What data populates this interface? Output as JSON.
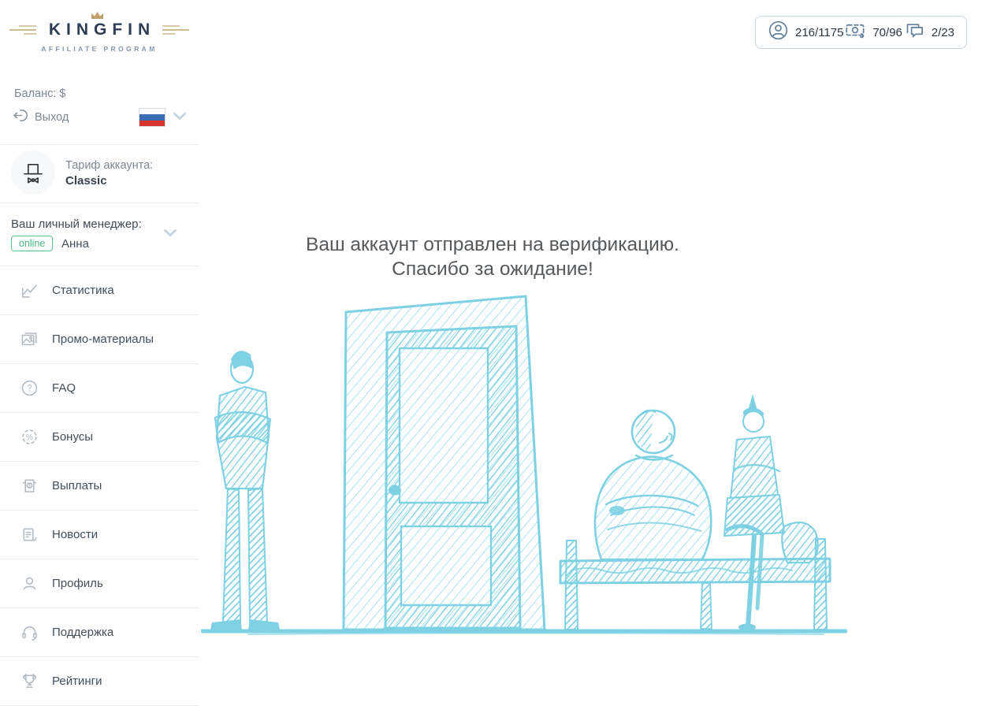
{
  "colors": {
    "sketch_cyan": "#7dd1e2",
    "brand_navy": "#2e3d54",
    "brand_gold": "#bfa06a",
    "brand_tan": "#d9cca7",
    "online_green": "#4cb583",
    "header_icon_slate": "#627f9b",
    "menu_icon_gray": "#b2bac2",
    "menu_text": "#42505f",
    "muted_text": "#7d8791",
    "heading_text": "#55595c",
    "divider": "#ececec",
    "stats_border": "#c9d5e0",
    "flag_blue": "#3a6db4",
    "flag_red": "#d6342c"
  },
  "logo": {
    "title": "KINGFIN",
    "subtitle": "AFFILIATE PROGRAM"
  },
  "header": {
    "stats": [
      {
        "icon": "user-circle-icon",
        "value": "216/1175"
      },
      {
        "icon": "cash-icon",
        "value": "70/96"
      },
      {
        "icon": "chat-icon",
        "value": "2/23"
      }
    ]
  },
  "sidebar": {
    "balance_label": "Баланс: $",
    "logout_label": "Выход",
    "language": {
      "flag_icon": "russia-flag-icon"
    },
    "tariff": {
      "label": "Тариф аккаунта:",
      "value": "Classic",
      "icon": "tophat-bowtie-icon"
    },
    "manager": {
      "label": "Ваш личный менеджер:",
      "status": "online",
      "name": "Анна"
    },
    "menu": [
      {
        "icon": "chart-icon",
        "label": "Статистика"
      },
      {
        "icon": "image-icon",
        "label": "Промо-материалы"
      },
      {
        "icon": "question-icon",
        "label": "FAQ"
      },
      {
        "icon": "percent-badge-icon",
        "label": "Бонусы"
      },
      {
        "icon": "cash-out-icon",
        "label": "Выплаты"
      },
      {
        "icon": "news-icon",
        "label": "Новости"
      },
      {
        "icon": "person-icon",
        "label": "Профиль"
      },
      {
        "icon": "headset-icon",
        "label": "Поддержка"
      },
      {
        "icon": "trophy-icon",
        "label": "Рейтинги"
      }
    ]
  },
  "main": {
    "heading_line1": "Ваш аккаунт отправлен на верификацию.",
    "heading_line2": "Спасибо за ожидание!",
    "illustration": "waiting-room-sketch"
  }
}
